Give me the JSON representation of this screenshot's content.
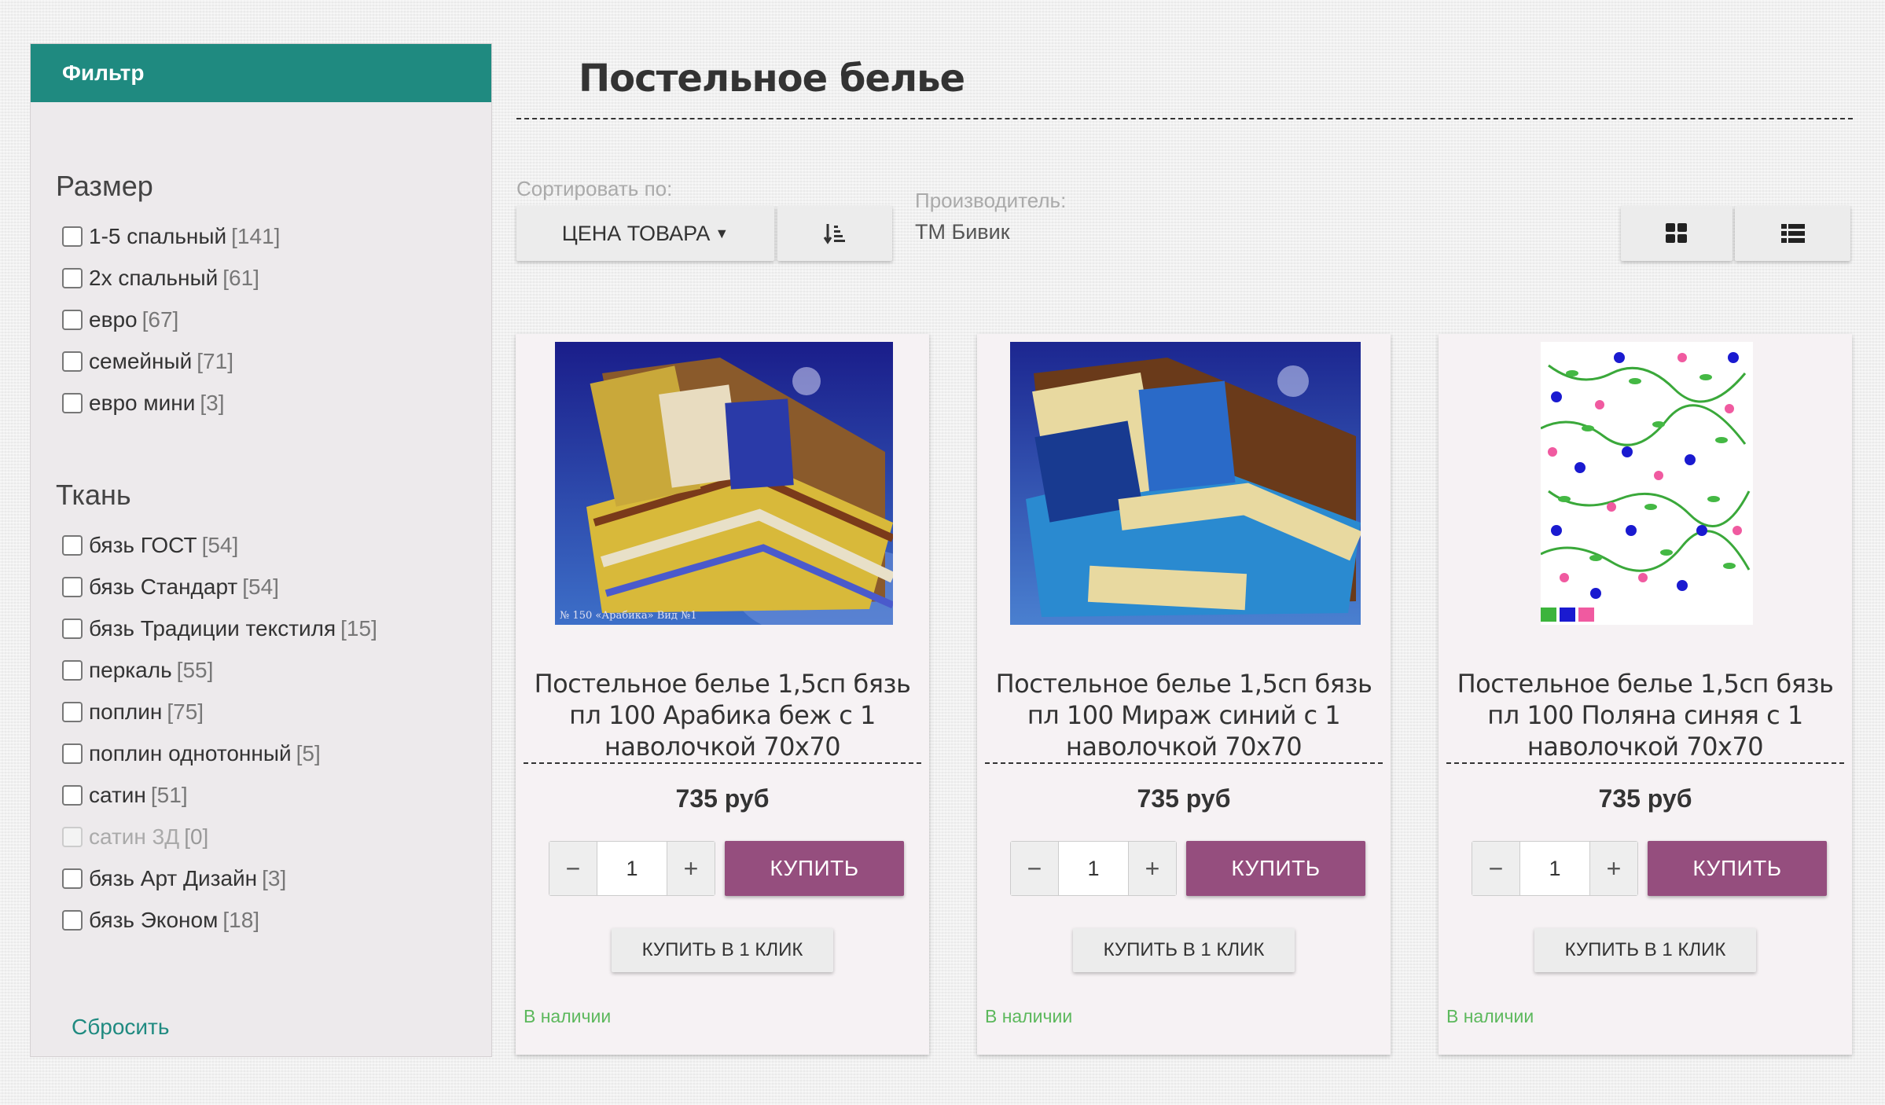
{
  "sidebar": {
    "header": "Фильтр",
    "groups": [
      {
        "title": "Размер",
        "items": [
          {
            "label": "1-5 спальный",
            "count": "[141]"
          },
          {
            "label": "2х спальный",
            "count": "[61]"
          },
          {
            "label": "евро",
            "count": "[67]"
          },
          {
            "label": "семейный",
            "count": "[71]"
          },
          {
            "label": "евро мини",
            "count": "[3]"
          }
        ]
      },
      {
        "title": "Ткань",
        "items": [
          {
            "label": "бязь ГОСТ",
            "count": "[54]"
          },
          {
            "label": "бязь Стандарт",
            "count": "[54]"
          },
          {
            "label": "бязь Традиции текстиля",
            "count": "[15]"
          },
          {
            "label": "перкаль",
            "count": "[55]"
          },
          {
            "label": "поплин",
            "count": "[75]"
          },
          {
            "label": "поплин однотонный",
            "count": "[5]"
          },
          {
            "label": "сатин",
            "count": "[51]"
          },
          {
            "label": "сатин 3Д",
            "count": "[0]",
            "disabled": true
          },
          {
            "label": "бязь Арт Дизайн",
            "count": "[3]"
          },
          {
            "label": "бязь Эконом",
            "count": "[18]"
          }
        ]
      }
    ],
    "reset": "Сбросить"
  },
  "page": {
    "title": "Постельное белье"
  },
  "sort": {
    "label": "Сортировать по:",
    "selected": "ЦЕНА ТОВАРА"
  },
  "maker": {
    "label": "Производитель:",
    "value": "ТМ Бивик"
  },
  "products": [
    {
      "name": "Постельное белье 1,5сп бязь пл 100 Арабика беж с 1 наволочкой 70х70",
      "price": "735 руб",
      "qty": "1",
      "buy": "КУПИТЬ",
      "oneclick": "КУПИТЬ В 1 КЛИК",
      "stock": "В наличии",
      "image_caption": "№ 150 «Арабика» Вид №1"
    },
    {
      "name": "Постельное белье 1,5сп бязь пл 100 Мираж синий с 1 наволочкой 70х70",
      "price": "735 руб",
      "qty": "1",
      "buy": "КУПИТЬ",
      "oneclick": "КУПИТЬ В 1 КЛИК",
      "stock": "В наличии"
    },
    {
      "name": "Постельное белье 1,5сп бязь пл 100 Поляна синяя с 1 наволочкой 70х70",
      "price": "735 руб",
      "qty": "1",
      "buy": "КУПИТЬ",
      "oneclick": "КУПИТЬ В 1 КЛИК",
      "stock": "В наличии"
    }
  ],
  "colors": {
    "accent": "#1f8a80",
    "buy": "#954e7e",
    "stock": "#5cb85c",
    "swatches": [
      "#3cb43c",
      "#1a1ad0",
      "#f05aa0"
    ]
  },
  "icons": {
    "sort_direction": "sort-amount-icon",
    "view_grid": "grid-view-icon",
    "view_list": "list-view-icon"
  }
}
